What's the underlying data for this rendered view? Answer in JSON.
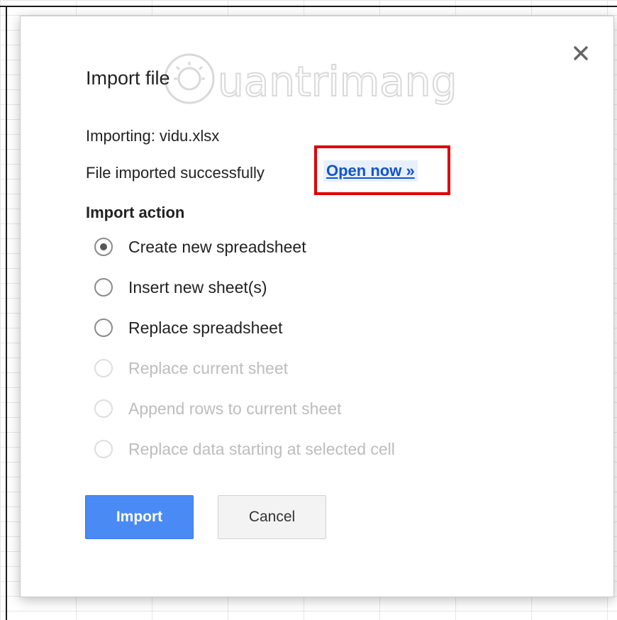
{
  "dialog": {
    "title": "Import file",
    "close_label": "close",
    "importing_text": "Importing: vidu.xlsx",
    "success_text": "File imported successfully",
    "open_link": "Open now »",
    "action_heading": "Import action",
    "options": [
      {
        "label": "Create new spreadsheet",
        "checked": true,
        "disabled": false
      },
      {
        "label": "Insert new sheet(s)",
        "checked": false,
        "disabled": false
      },
      {
        "label": "Replace spreadsheet",
        "checked": false,
        "disabled": false
      },
      {
        "label": "Replace current sheet",
        "checked": false,
        "disabled": true
      },
      {
        "label": "Append rows to current sheet",
        "checked": false,
        "disabled": true
      },
      {
        "label": "Replace data starting at selected cell",
        "checked": false,
        "disabled": true
      }
    ],
    "import_button": "Import",
    "cancel_button": "Cancel"
  },
  "watermark": {
    "text": "uantrimang"
  },
  "colors": {
    "primary_button": "#4a8af4",
    "link": "#1155cc",
    "highlight_box": "#e00000",
    "disabled_text": "#bdbdbd"
  },
  "icons": {
    "close": "close-icon",
    "watermark_logo": "sun-logo-icon"
  }
}
